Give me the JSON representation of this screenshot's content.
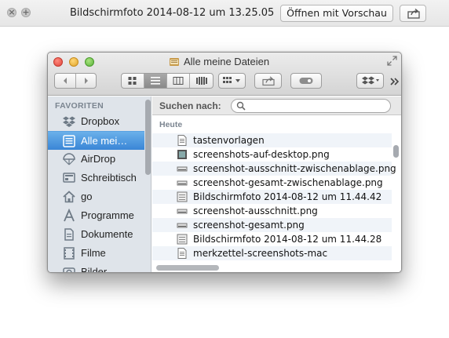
{
  "quicklook": {
    "title": "Bildschirmfoto 2014-08-12 um 13.25.05",
    "open_button": "Öffnen mit Vorschau"
  },
  "window": {
    "title": "Alle meine Dateien"
  },
  "sidebar": {
    "heading": "FAVORITEN",
    "items": [
      {
        "label": "Dropbox",
        "icon": "dropbox-icon"
      },
      {
        "label": "Alle mei…",
        "icon": "all-files-icon",
        "selected": true
      },
      {
        "label": "AirDrop",
        "icon": "airdrop-icon"
      },
      {
        "label": "Schreibtisch",
        "icon": "desktop-icon"
      },
      {
        "label": "go",
        "icon": "home-icon"
      },
      {
        "label": "Programme",
        "icon": "applications-icon"
      },
      {
        "label": "Dokumente",
        "icon": "documents-icon"
      },
      {
        "label": "Filme",
        "icon": "movies-icon"
      },
      {
        "label": "Bilder",
        "icon": "pictures-icon"
      }
    ]
  },
  "search": {
    "label": "Suchen nach:",
    "value": ""
  },
  "list": {
    "section": "Heute",
    "files": [
      {
        "name": "tastenvorlagen",
        "icon": "text-document-icon"
      },
      {
        "name": "screenshots-auf-desktop.png",
        "icon": "image-file-icon"
      },
      {
        "name": "screenshot-ausschnitt-zwischenablage.png",
        "icon": "image-file-icon"
      },
      {
        "name": "screenshot-gesamt-zwischenablage.png",
        "icon": "image-file-icon"
      },
      {
        "name": "Bildschirmfoto 2014-08-12 um 11.44.42",
        "icon": "image-file-icon"
      },
      {
        "name": "screenshot-ausschnitt.png",
        "icon": "image-file-icon"
      },
      {
        "name": "screenshot-gesamt.png",
        "icon": "image-file-icon"
      },
      {
        "name": "Bildschirmfoto 2014-08-12 um 11.44.28",
        "icon": "image-file-icon"
      },
      {
        "name": "merkzettel-screenshots-mac",
        "icon": "text-document-icon"
      }
    ]
  },
  "colors": {
    "selection": "#3a86d6",
    "sidebar_bg": "#dfe4ea",
    "row_stripe": "#f0f4f9"
  }
}
